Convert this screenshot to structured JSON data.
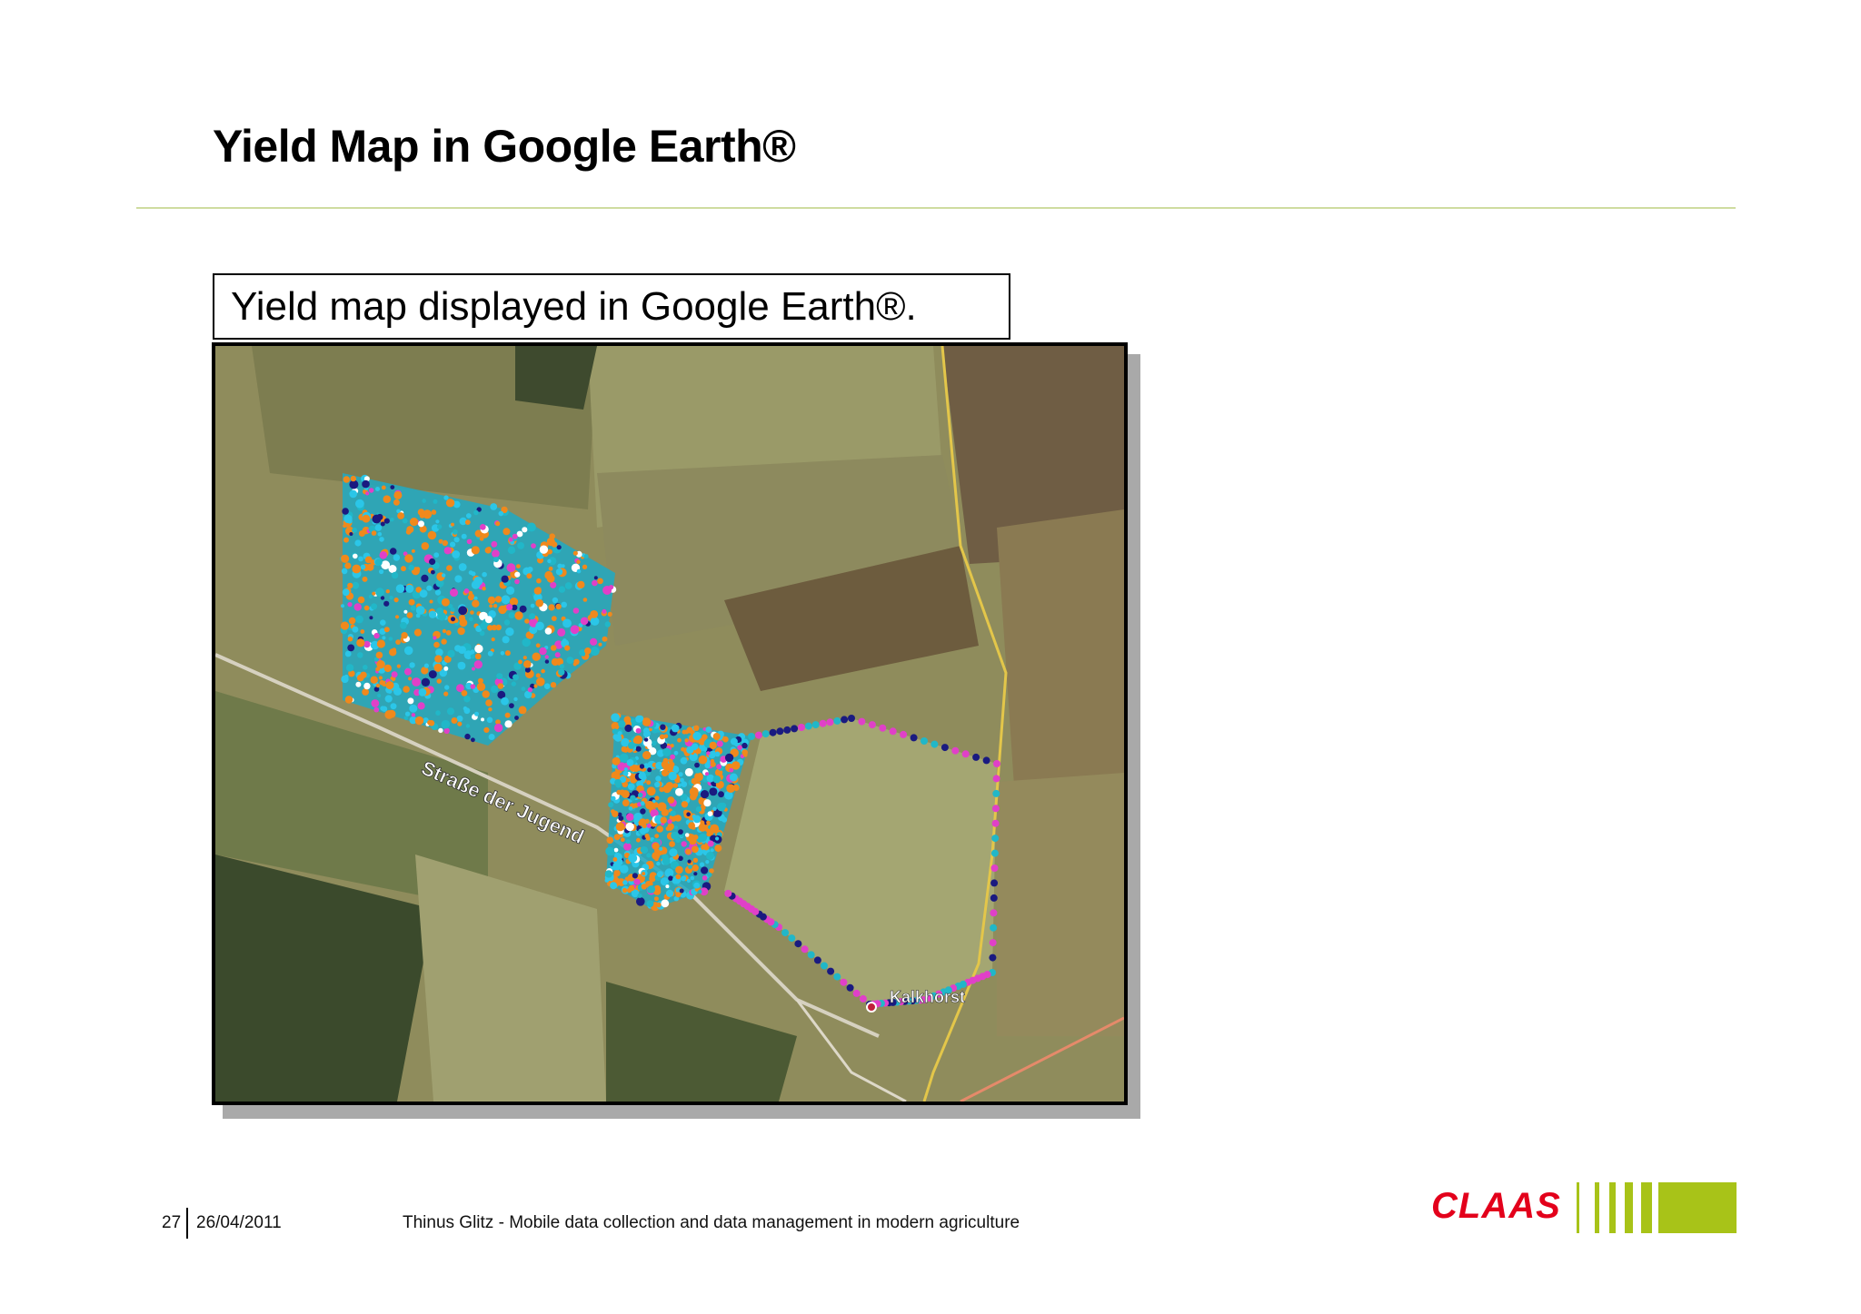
{
  "slide": {
    "title": "Yield Map in Google Earth®",
    "caption": "Yield  map displayed in Google Earth®."
  },
  "map": {
    "labels": {
      "road": "Straße der Jugend",
      "village": "Kalkhorst"
    },
    "marker_colors": [
      "#21b7c8",
      "#2bc6e8",
      "#f0891c",
      "#e040c8",
      "#1a1a80",
      "#ffffff"
    ]
  },
  "footer": {
    "page_number": "27",
    "date": "26/04/2011",
    "text": "Thinus Glitz - Mobile data collection and data management in modern agriculture"
  },
  "logo": {
    "wordmark": "CLAAS",
    "brand_red": "#e3001b",
    "brand_green": "#a8c318"
  }
}
